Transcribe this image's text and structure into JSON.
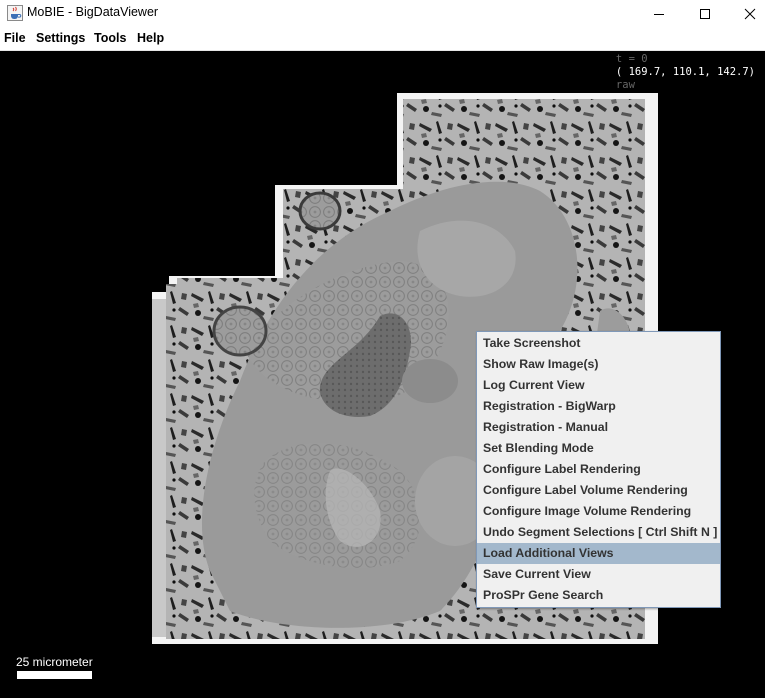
{
  "window": {
    "title": "MoBIE - BigDataViewer",
    "app_icon": "java-cup-icon",
    "controls": [
      "minimize-icon",
      "maximize-icon",
      "close-icon"
    ]
  },
  "menubar": {
    "items": [
      {
        "label": "File"
      },
      {
        "label": "Settings"
      },
      {
        "label": "Tools"
      },
      {
        "label": "Help"
      }
    ]
  },
  "viewer": {
    "overlay": {
      "timepoint": "t = 0",
      "coordinates": "( 169.7, 110.1, 142.7)",
      "source": "raw"
    },
    "scalebar_label": "25 micrometer",
    "colors": {
      "background": "#000000",
      "tissue": "#9a9a9a",
      "menu_highlight": "#a3b8cc"
    }
  },
  "context_menu": {
    "items": [
      {
        "label": "Take Screenshot"
      },
      {
        "label": "Show Raw Image(s)"
      },
      {
        "label": "Log Current View"
      },
      {
        "label": "Registration - BigWarp"
      },
      {
        "label": "Registration - Manual"
      },
      {
        "label": "Set Blending Mode"
      },
      {
        "label": "Configure Label Rendering"
      },
      {
        "label": "Configure Label Volume Rendering"
      },
      {
        "label": "Configure Image Volume Rendering"
      },
      {
        "label": "Undo Segment Selections [ Ctrl Shift N ]"
      },
      {
        "label": "Load Additional Views",
        "highlighted": true
      },
      {
        "label": "Save Current View"
      },
      {
        "label": "ProSPr Gene Search"
      }
    ]
  }
}
